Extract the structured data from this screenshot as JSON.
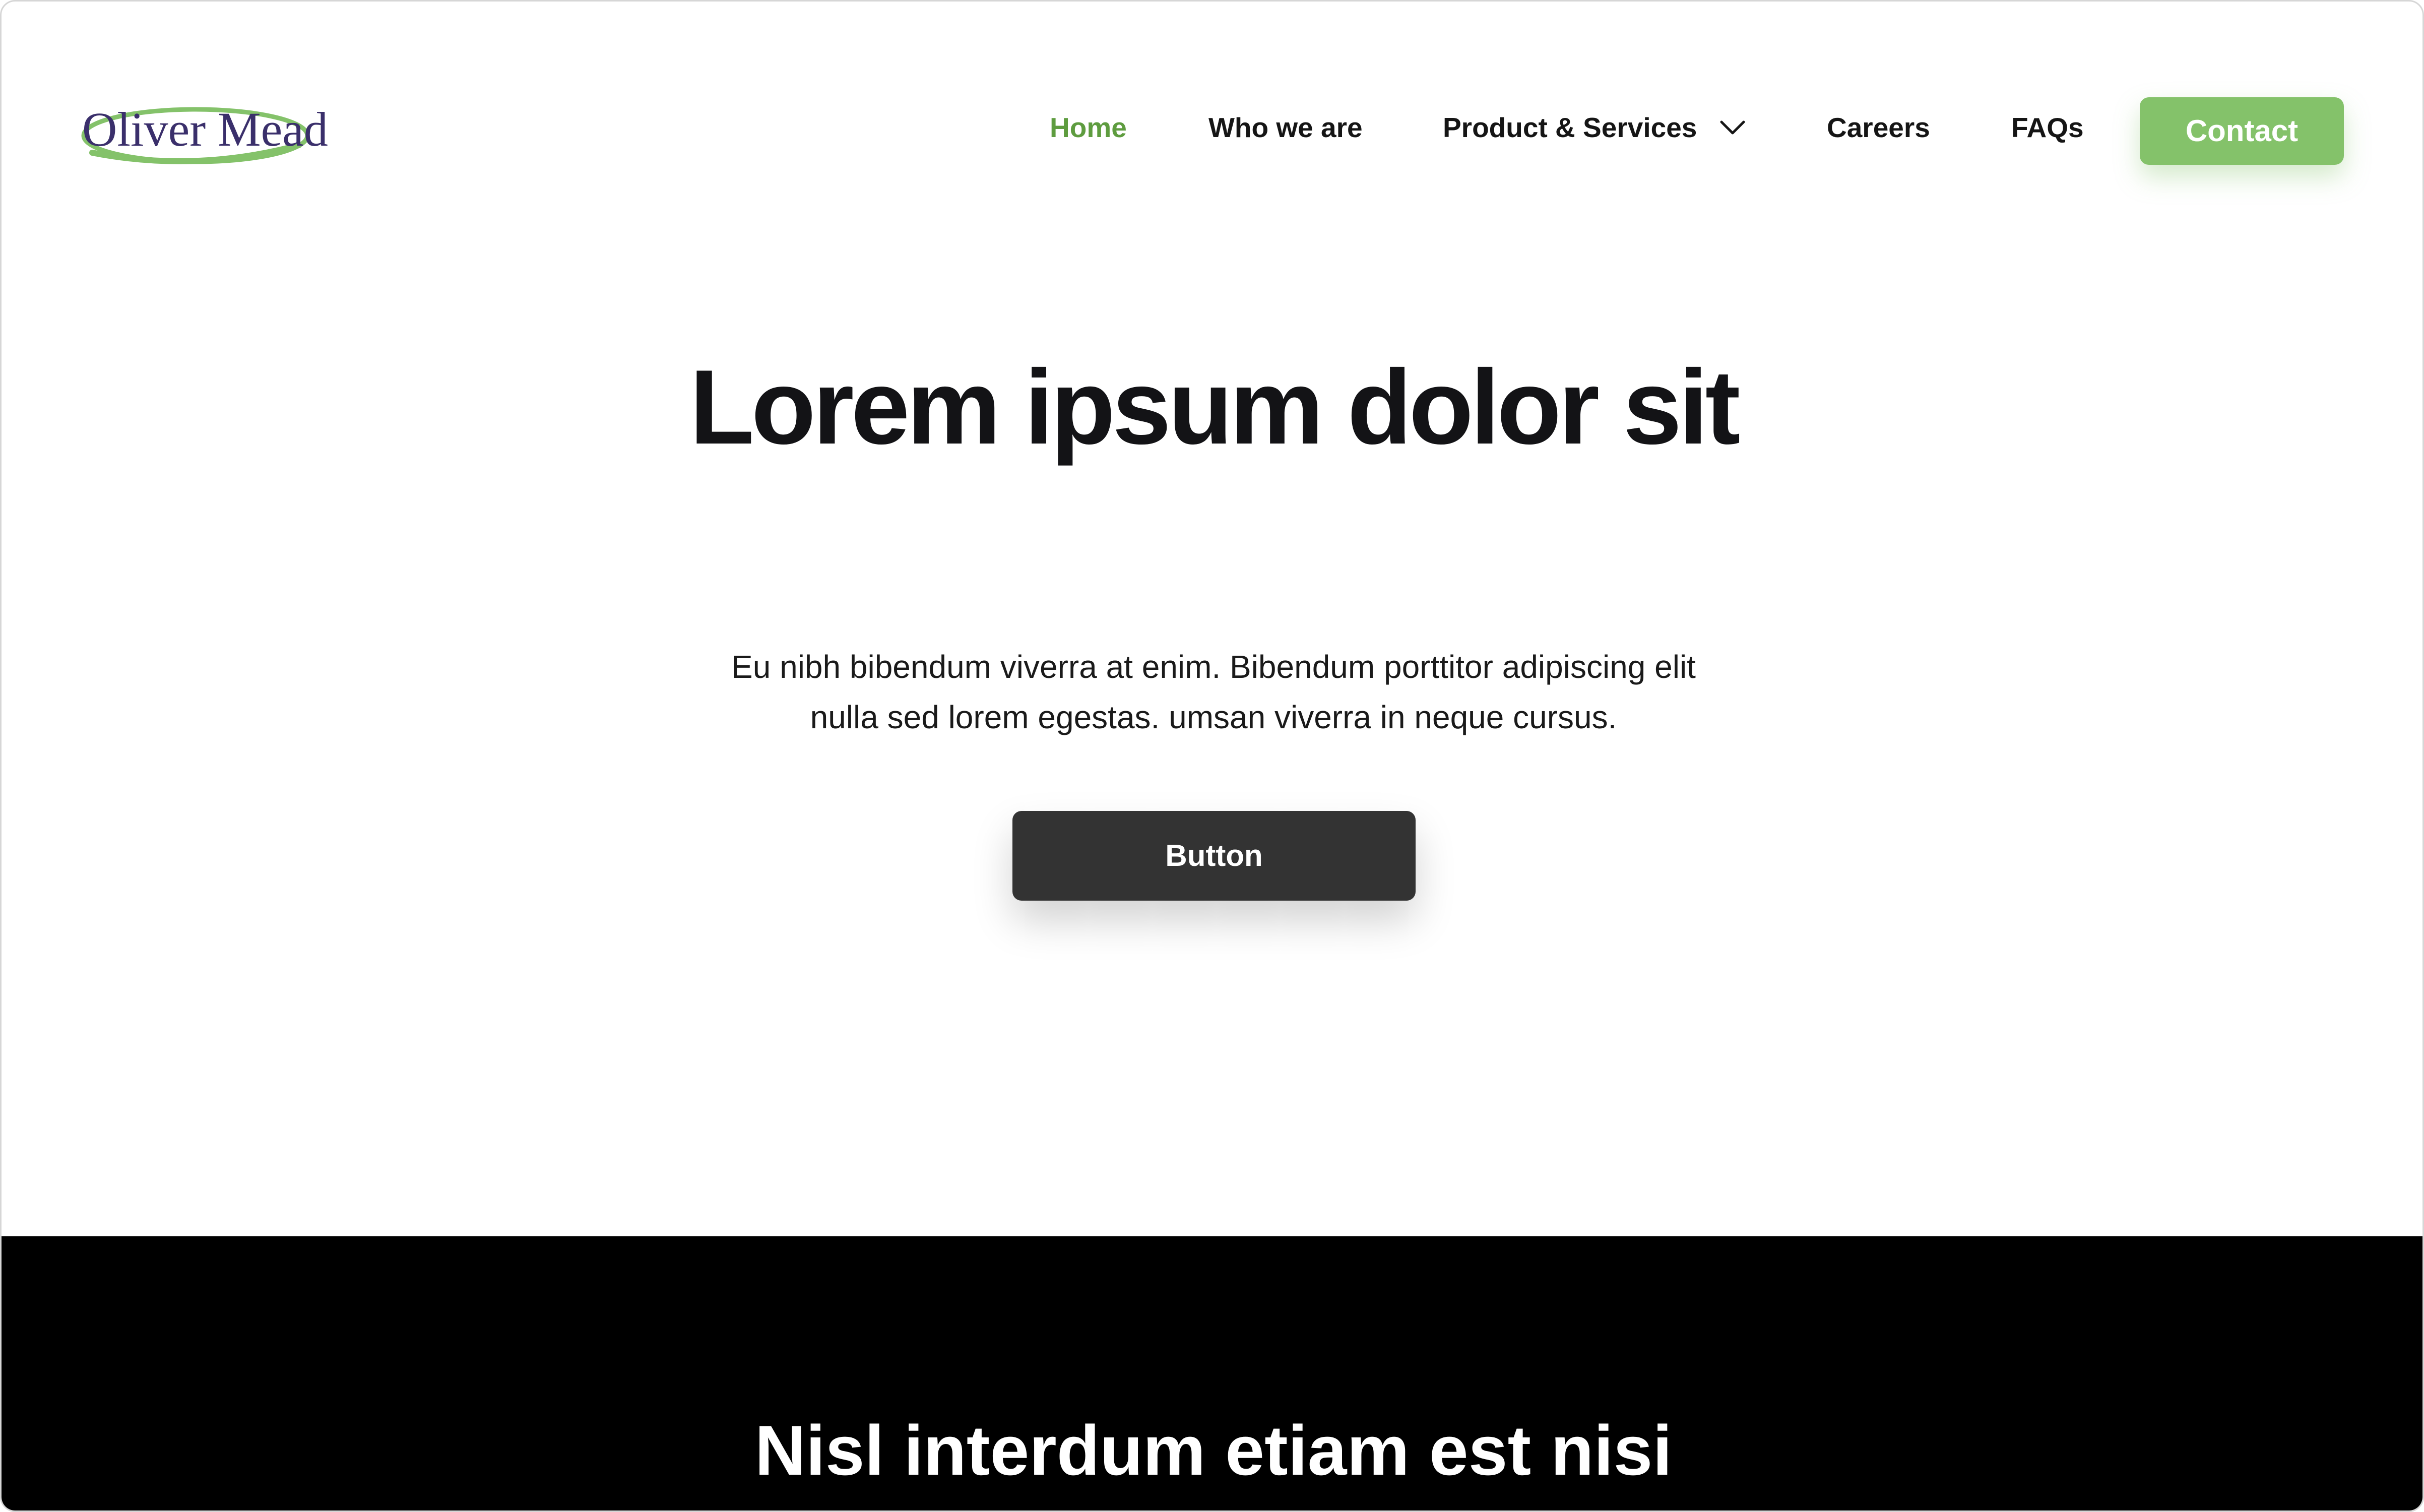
{
  "header": {
    "logo": {
      "text": "Oliver Mead",
      "text_color": "#3a2f6b",
      "swoosh_color": "#84c26a"
    },
    "nav": {
      "items": [
        {
          "label": "Home",
          "active": true
        },
        {
          "label": "Who we are",
          "active": false
        },
        {
          "label": "Product & Services",
          "active": false,
          "has_dropdown": true
        },
        {
          "label": "Careers",
          "active": false
        },
        {
          "label": "FAQs",
          "active": false
        }
      ],
      "active_color": "#5e9c3f"
    },
    "contact_button": {
      "label": "Contact",
      "color": "#84c26a"
    }
  },
  "hero": {
    "title": "Lorem ipsum dolor sit",
    "description": "Eu nibh bibendum viverra at enim. Bibendum porttitor adipiscing elit nulla sed lorem egestas. umsan viverra in neque cursus.",
    "button": {
      "label": "Button",
      "color": "#333333"
    }
  },
  "dark_section": {
    "title": "Nisl interdum etiam est nisi",
    "background": "#000000"
  },
  "icons": {
    "dropdown": "chevron-down-icon"
  }
}
